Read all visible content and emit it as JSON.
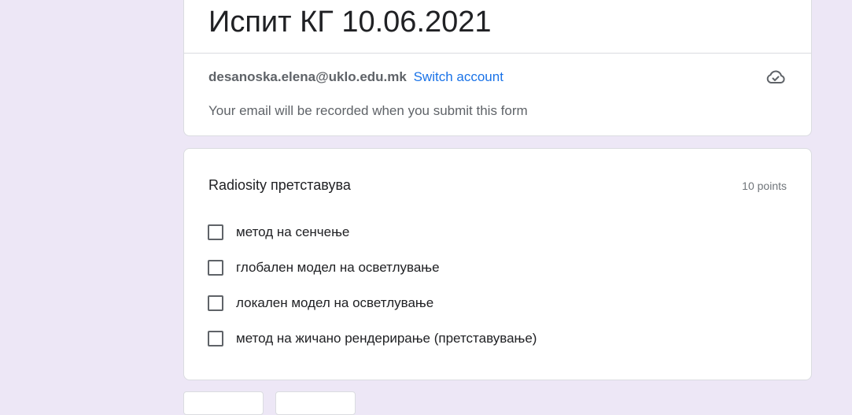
{
  "form": {
    "title": "Испит КГ 10.06.2021",
    "account_email": "desanoska.elena@uklo.edu.mk",
    "switch_account_label": "Switch account",
    "email_notice": "Your email will be recorded when you submit this form"
  },
  "question": {
    "title": "Radiosity претставува",
    "points": "10 points",
    "options": [
      {
        "label": "метод на сенчење",
        "checked": false
      },
      {
        "label": "глобален модел на осветлување",
        "checked": false
      },
      {
        "label": "локален модел на осветлување",
        "checked": false
      },
      {
        "label": "метод на жичано рендерирање (претставување)",
        "checked": false
      }
    ]
  },
  "icons": {
    "cloud_status": "cloud-done-icon"
  },
  "colors": {
    "background": "#ede7f6",
    "link": "#1a73e8"
  }
}
